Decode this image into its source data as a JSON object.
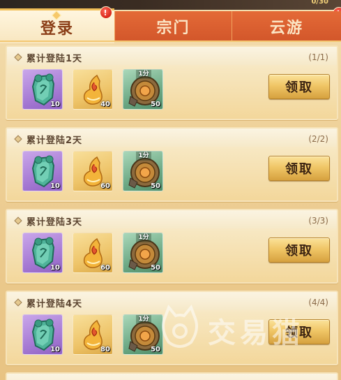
{
  "top_counter": "0/30",
  "tabs": [
    {
      "label": "登录",
      "active": true,
      "badge": "!"
    },
    {
      "label": "宗门",
      "active": false,
      "badge": "!"
    },
    {
      "label": "云游",
      "active": false
    }
  ],
  "cards": [
    {
      "title": "累计登陆1天",
      "progress": "(1/1)",
      "rewards": [
        {
          "icon": "jade-token-icon",
          "quantity": "10",
          "frame": "purple"
        },
        {
          "icon": "gold-flame-gourd-icon",
          "quantity": "40",
          "frame": "gold"
        },
        {
          "icon": "bronze-coin-icon",
          "quantity": "50",
          "frame": "green",
          "tag": "1分"
        }
      ],
      "button": "领取"
    },
    {
      "title": "累计登陆2天",
      "progress": "(2/2)",
      "rewards": [
        {
          "icon": "jade-token-icon",
          "quantity": "10",
          "frame": "purple"
        },
        {
          "icon": "gold-flame-gourd-icon",
          "quantity": "60",
          "frame": "gold"
        },
        {
          "icon": "bronze-coin-icon",
          "quantity": "50",
          "frame": "green",
          "tag": "1分"
        }
      ],
      "button": "领取"
    },
    {
      "title": "累计登陆3天",
      "progress": "(3/3)",
      "rewards": [
        {
          "icon": "jade-token-icon",
          "quantity": "10",
          "frame": "purple"
        },
        {
          "icon": "gold-flame-gourd-icon",
          "quantity": "60",
          "frame": "gold"
        },
        {
          "icon": "bronze-coin-icon",
          "quantity": "50",
          "frame": "green",
          "tag": "1分"
        }
      ],
      "button": "领取"
    },
    {
      "title": "累计登陆4天",
      "progress": "(4/4)",
      "rewards": [
        {
          "icon": "jade-token-icon",
          "quantity": "10",
          "frame": "purple"
        },
        {
          "icon": "gold-flame-gourd-icon",
          "quantity": "80",
          "frame": "gold"
        },
        {
          "icon": "bronze-coin-icon",
          "quantity": "50",
          "frame": "green",
          "tag": "1分"
        }
      ],
      "button": "领取"
    }
  ],
  "watermark": "交易猫",
  "colors": {
    "active_tab_text": "#8a3d16",
    "inactive_tab_bg": "#d85b2d",
    "badge_red": "#d8261a",
    "button_gold": "#f0c667",
    "card_bg": "#f7e7c1"
  }
}
